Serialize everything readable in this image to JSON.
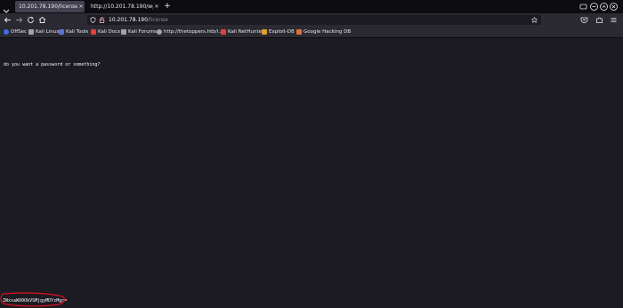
{
  "tabs": [
    {
      "label": "10.201.78.190/license",
      "active": true
    },
    {
      "label": "http://10.201.78.190/wp-logi",
      "active": false
    }
  ],
  "navbar": {
    "url_host": "10.201.78.190",
    "url_path": "/license"
  },
  "bookmarks": [
    {
      "label": "OffSec",
      "icon": "offsec-icon",
      "color": "#3d6fe0"
    },
    {
      "label": "Kali Linux",
      "icon": "kali-icon",
      "color": "#9ea4ad"
    },
    {
      "label": "Kali Tools",
      "icon": "kali-tools-icon",
      "color": "#5575d8"
    },
    {
      "label": "Kali Docs",
      "icon": "kali-docs-icon",
      "color": "#e04040"
    },
    {
      "label": "Kali Forums",
      "icon": "kali-forums-icon",
      "color": "#9ea4ad"
    },
    {
      "label": "http://thetoppers.htb/i...",
      "icon": "globe-icon",
      "color": "#9ea4ad"
    },
    {
      "label": "Kali NetHunter",
      "icon": "nethunter-icon",
      "color": "#e04040"
    },
    {
      "label": "Exploit-DB",
      "icon": "exploit-db-icon",
      "color": "#e0a030"
    },
    {
      "label": "Google Hacking DB",
      "icon": "ghdb-icon",
      "color": "#e07030"
    }
  ],
  "content": {
    "message": "do you want a password or something?",
    "encoded_string": "ZWxsaW90OkVSMjgyMDYzMgo="
  },
  "colors": {
    "highlight": "#e01020",
    "background": "#1c1b22"
  }
}
